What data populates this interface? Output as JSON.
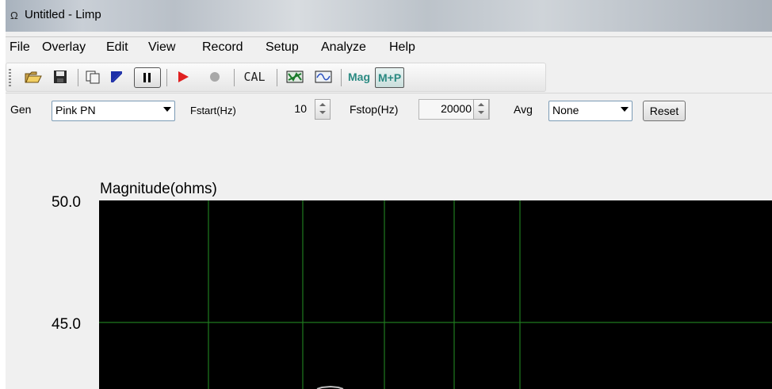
{
  "window": {
    "title": "Untitled - Limp",
    "icon": "omega-icon"
  },
  "menu": {
    "items": [
      "File",
      "Overlay",
      "Edit",
      "View",
      "Record",
      "Setup",
      "Analyze",
      "Help"
    ]
  },
  "toolbar": {
    "cal_label": "CAL",
    "mag_label": "Mag",
    "mp_label": "M+P"
  },
  "controls": {
    "gen_label": "Gen",
    "gen_value": "Pink PN",
    "fstart_label": "Fstart(Hz)",
    "fstart_value": "10",
    "fstop_label": "Fstop(Hz)",
    "fstop_value": "20000",
    "avg_label": "Avg",
    "avg_value": "None",
    "reset_label": "Reset"
  },
  "chart_data": {
    "type": "line",
    "title": "Magnitude(ohms)",
    "yticks": [
      "50.0",
      "45.0"
    ],
    "ylim": [
      45.0,
      50.0
    ],
    "grid": true,
    "colors": {
      "background": "#000000",
      "grid": "#1f7a1f",
      "trace": "#bfbfbf"
    }
  }
}
